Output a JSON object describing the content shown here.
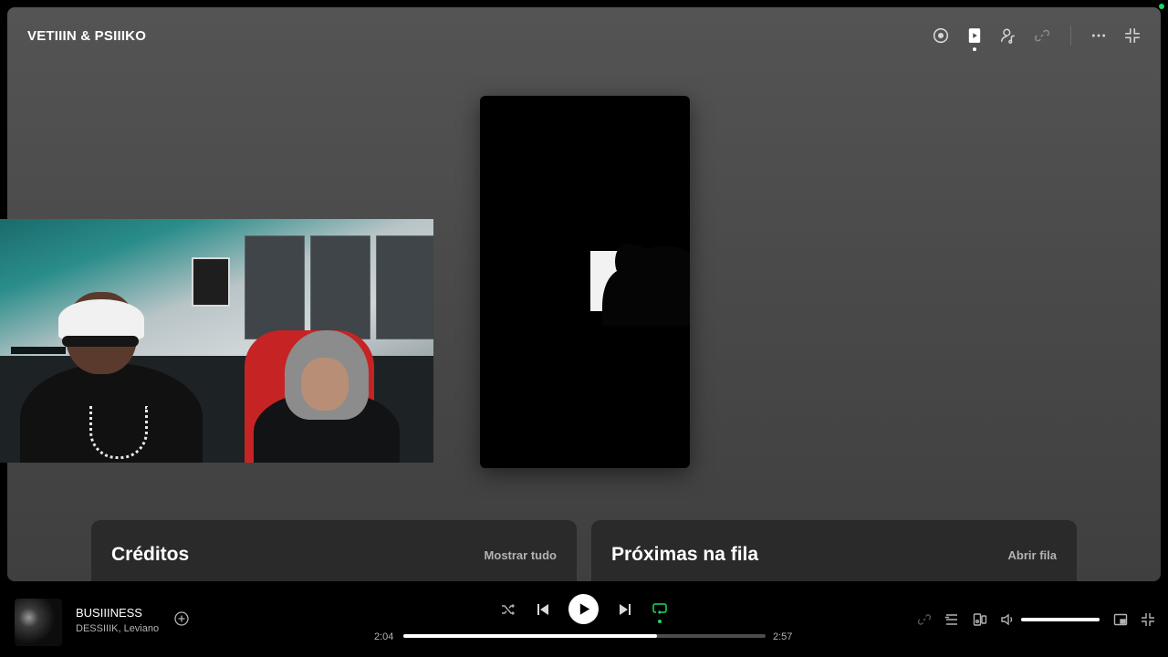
{
  "npv": {
    "title": "VETIIIN & PSIIIKO"
  },
  "top_icons": [
    "disc-icon",
    "video-icon",
    "user-music-icon",
    "link-icon",
    "more-icon",
    "minimize-icon"
  ],
  "cards": {
    "credits": {
      "title": "Créditos",
      "link": "Mostrar tudo"
    },
    "queue": {
      "title": "Próximas na fila",
      "link": "Abrir fila"
    }
  },
  "player": {
    "track_title": "BUSIIINESS",
    "artists": "DESSIIIK, Leviano",
    "elapsed": "2:04",
    "total": "2:57",
    "progress_fraction": 0.7,
    "volume_fraction": 1.0,
    "repeat_active": true,
    "colors": {
      "accent": "#1ed760",
      "background": "#000000",
      "muted_text": "#b3b3b3"
    }
  }
}
